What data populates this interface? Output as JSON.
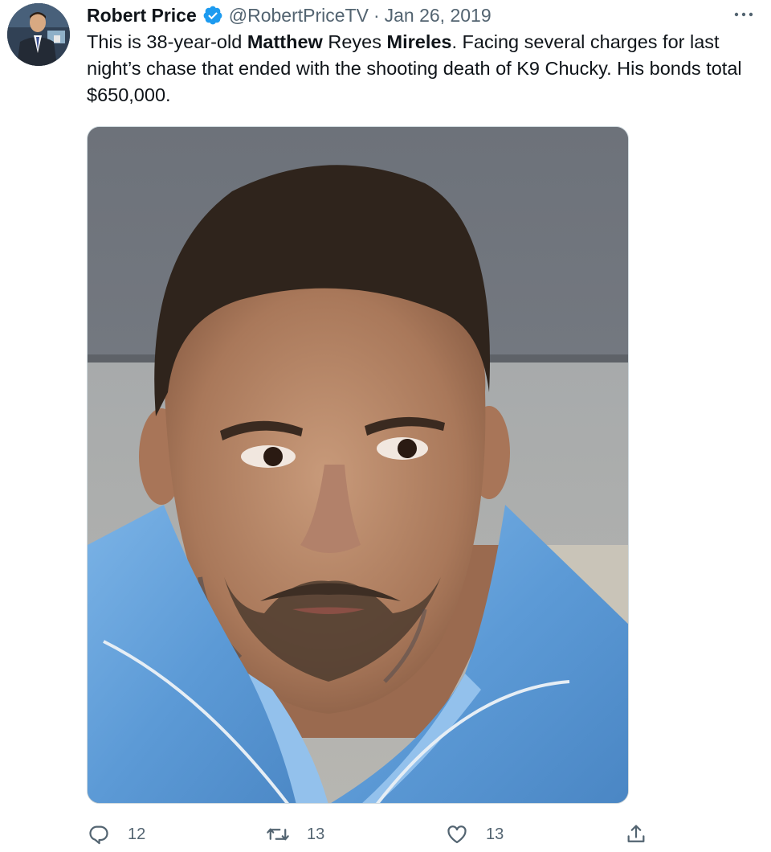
{
  "tweet": {
    "author": {
      "name": "Robert Price",
      "handle": "@RobertPriceTV",
      "verified": true,
      "avatar_icon": "profile-photo"
    },
    "separator": "·",
    "date": "Jan 26, 2019",
    "more_icon": "more-horizontal-icon",
    "text_segments": [
      {
        "text": "This is 38-year-old ",
        "bold": false
      },
      {
        "text": "Matthew",
        "bold": true
      },
      {
        "text": " Reyes ",
        "bold": false
      },
      {
        "text": "Mireles",
        "bold": true
      },
      {
        "text": ". Facing several charges for last night’s chase that ended with the shooting death of K9 Chucky. His bonds total $650,000.",
        "bold": false
      }
    ],
    "media": {
      "type": "photo",
      "description_icon": "mugshot-photo"
    },
    "actions": {
      "reply": {
        "icon": "reply-icon",
        "count": "12"
      },
      "retweet": {
        "icon": "retweet-icon",
        "count": "13"
      },
      "like": {
        "icon": "like-icon",
        "count": "13"
      },
      "share": {
        "icon": "share-icon"
      }
    }
  },
  "colors": {
    "text": "#0f1419",
    "secondary": "#536471",
    "verified_badge": "#1d9bf0",
    "border": "#cfd9de"
  }
}
